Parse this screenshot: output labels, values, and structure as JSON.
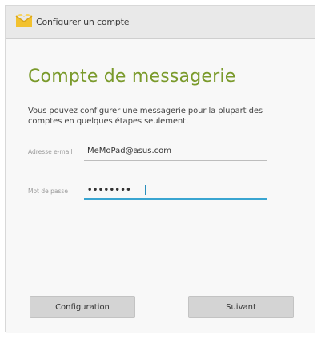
{
  "window": {
    "title": "Configurer un compte"
  },
  "page": {
    "heading": "Compte de messagerie",
    "intro": "Vous pouvez configurer une messagerie pour la plupart des comptes en quelques étapes seulement."
  },
  "form": {
    "email": {
      "label": "Adresse e-mail",
      "value": "MeMoPad@asus.com"
    },
    "password": {
      "label": "Mot de passe",
      "value": "••••••••"
    }
  },
  "buttons": {
    "manual_setup": "Configuration",
    "next": "Suivant"
  },
  "colors": {
    "heading": "#7a9a2b",
    "focus": "#39a5d1"
  },
  "icons": {
    "app": "envelope-icon"
  }
}
